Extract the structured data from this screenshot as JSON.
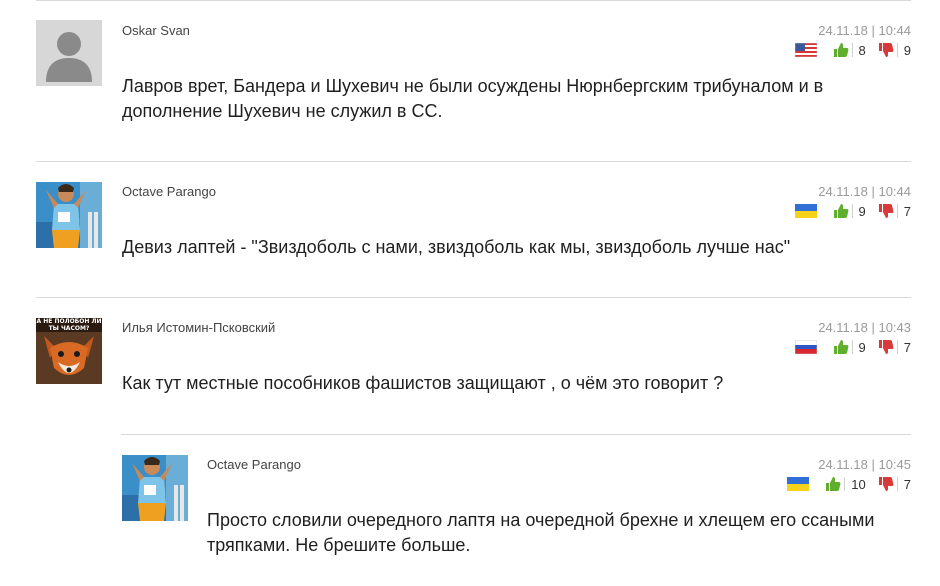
{
  "comments": [
    {
      "author": "Oskar Svan",
      "datetime": "24.11.18 | 10:44",
      "flag": "usa-flag-icon",
      "likes": "8",
      "dislikes": "9",
      "text": "Лавров врет, Бандера и Шухевич не были осуждены Нюрнбергским трибуналом и в дополнение Шухевич не служил в СС.",
      "avatar": "default-avatar-icon"
    },
    {
      "author": "Octave Parango",
      "datetime": "24.11.18 | 10:44",
      "flag": "ukraine-flag-icon",
      "likes": "9",
      "dislikes": "7",
      "text": "Девиз лаптей - \"Звиздоболь с нами, звиздоболь как мы, звиздоболь лучше нас\"",
      "avatar": "athlete-photo-avatar"
    },
    {
      "author": "Илья Истомин-Псковский",
      "datetime": "24.11.18 | 10:43",
      "flag": "russia-flag-icon",
      "likes": "9",
      "dislikes": "7",
      "text": "Как тут местные пособников фашистов защищают , о чём это говорит ?",
      "avatar": "fox-meme-avatar",
      "avatar_caption": "А НЕ ПОЛОБОН ЛИ ТЫ ЧАСОМ?"
    },
    {
      "author": "Octave Parango",
      "datetime": "24.11.18 | 10:45",
      "flag": "ukraine-flag-icon",
      "likes": "10",
      "dislikes": "7",
      "text": "Просто словили очередного лаптя на очередной брехне и хлещем его ссаными тряпками. Не брешите больше.",
      "avatar": "athlete-photo-avatar"
    }
  ],
  "colors": {
    "like": "#5fae2e",
    "dislike": "#d83a3a",
    "meta": "#9a9a9a",
    "divider": "#d9d9d9"
  }
}
